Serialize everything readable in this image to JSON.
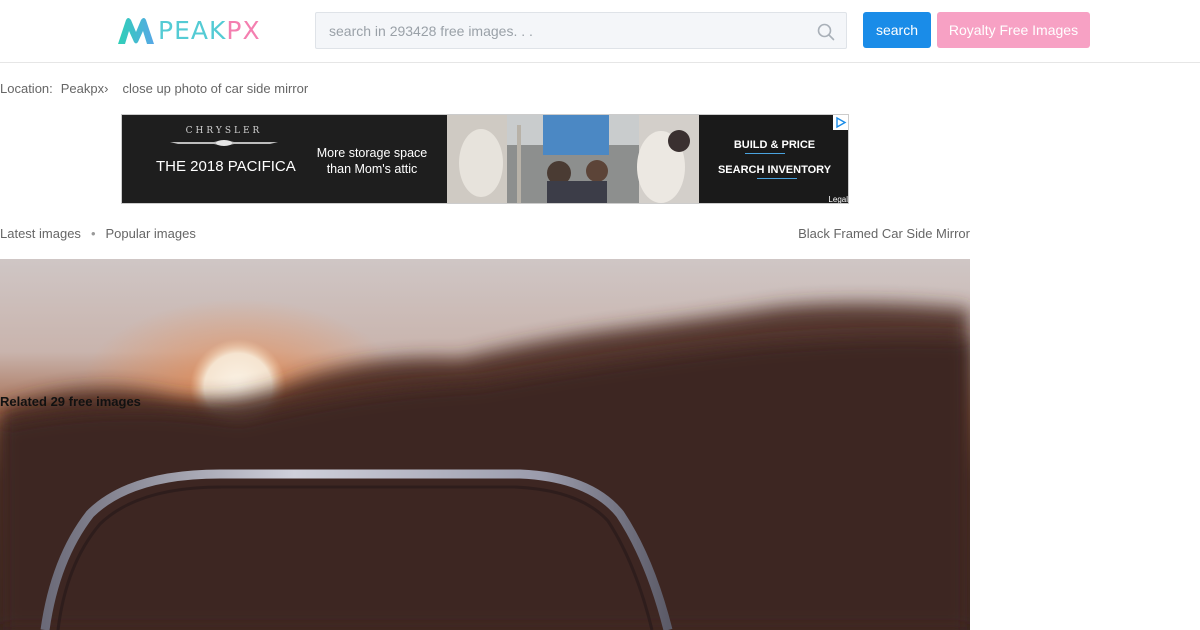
{
  "header": {
    "logo": {
      "text_peak": "PEAK",
      "text_px": "PX",
      "colors": {
        "peak": "#54cbd4",
        "px": "#f47fb0",
        "mark_start": "#2fd0b7",
        "mark_end": "#57a7e6"
      }
    },
    "search": {
      "placeholder": "search in 293428 free images. . .",
      "value": "",
      "icon": "search-icon"
    },
    "search_button_label": "search",
    "royalty_button_label": "Royalty Free Images",
    "colors": {
      "search_button": "#1a8ce8",
      "royalty_button": "#f7a1c4"
    }
  },
  "breadcrumb": {
    "prefix": "Location:",
    "items": [
      {
        "label": "Peakpx"
      }
    ],
    "separator": "›",
    "current": "close up photo of car side mirror"
  },
  "ad": {
    "brand": "CHRYSLER",
    "model": "THE 2018 PACIFICA",
    "tagline_line1": "More storage space",
    "tagline_line2": "than Mom's attic",
    "cta_build": "BUILD & PRICE",
    "cta_inventory": "SEARCH INVENTORY",
    "legal": "Legal",
    "choice_icon": "adchoices-icon"
  },
  "subnav": {
    "latest": "Latest images",
    "separator": "•",
    "popular": "Popular images"
  },
  "image_title": "Black Framed Car Side Mirror",
  "related": "Related 29 free images"
}
